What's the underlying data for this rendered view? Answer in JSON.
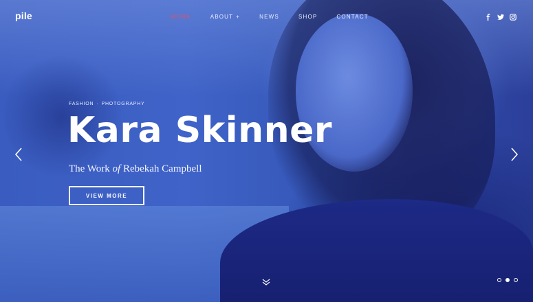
{
  "brand": {
    "logo": "pile"
  },
  "nav": {
    "items": [
      {
        "label": "WORK",
        "active": true
      },
      {
        "label": "ABOUT",
        "has_submenu": true,
        "submenu_indicator": "+"
      },
      {
        "label": "NEWS"
      },
      {
        "label": "SHOP"
      },
      {
        "label": "CONTACT"
      }
    ]
  },
  "social": {
    "icons": [
      "facebook-icon",
      "twitter-icon",
      "instagram-icon"
    ]
  },
  "hero": {
    "kicker": {
      "category_1": "FASHION",
      "separator": "·",
      "category_2": "PHOTOGRAPHY"
    },
    "title": "Kara Skinner",
    "subtitle": {
      "part_1": "The Work ",
      "italic": "of",
      "part_2": " Rebekah Campbell"
    },
    "cta_label": "VIEW MORE"
  },
  "slider": {
    "slide_count": 3,
    "active_index": 1
  },
  "colors": {
    "accent_active_nav": "#d9536a",
    "overlay_tint": "#3a5cc0",
    "text": "#ffffff"
  }
}
